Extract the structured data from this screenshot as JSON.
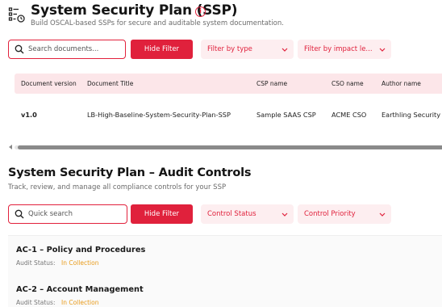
{
  "header": {
    "title": "System Security Plan (SSP)",
    "info_glyph": "i",
    "subtitle": "Build OSCAL-based SSPs for secure and auditable system documentation."
  },
  "documents_toolbar": {
    "search_placeholder": "Search documents...",
    "hide_filter_label": "Hide Filter",
    "filter_type_label": "Filter by type",
    "filter_impact_label": "Filter by impact le..."
  },
  "documents_table": {
    "columns": [
      "Document version",
      "Document Title",
      "CSP name",
      "CSO name",
      "Author name"
    ],
    "rows": [
      {
        "version": "v1.0",
        "title": "LB-High-Baseline-System-Security-Plan-SSP",
        "csp_name": "Sample SAAS CSP",
        "cso_name": "ACME CSO",
        "author_name": "Earthling Security"
      }
    ]
  },
  "audit_section": {
    "title": "System Security Plan – Audit Controls",
    "subtitle": "Track, review, and manage all compliance controls for your SSP"
  },
  "audit_toolbar": {
    "search_placeholder": "Quick search",
    "hide_filter_label": "Hide Filter",
    "status_filter_label": "Control Status",
    "priority_filter_label": "Control Priority"
  },
  "controls": [
    {
      "title": "AC-1 – Policy and Procedures",
      "status_label": "Audit Status:",
      "status_value": "In Collection"
    },
    {
      "title": "AC-2 – Account Management",
      "status_label": "Audit Status:",
      "status_value": "In Collection"
    }
  ],
  "colors": {
    "accent": "#e0213c",
    "accent_light": "#fdeef0",
    "status_in_collection": "#e89b1a"
  },
  "icons": [
    "checklist-icon",
    "info-icon",
    "search-icon",
    "chevron-down-icon"
  ]
}
